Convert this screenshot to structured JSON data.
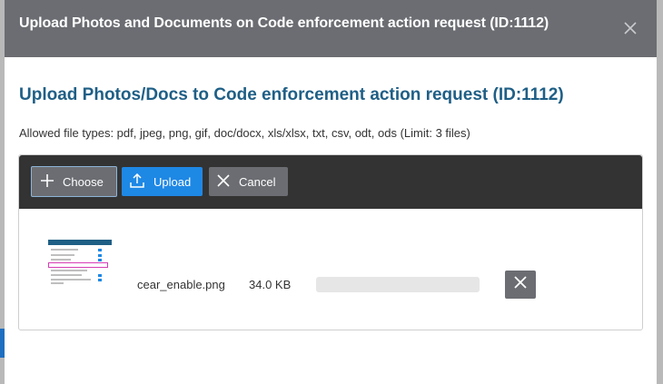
{
  "dialog": {
    "title": "Upload Photos and Documents on Code enforcement action request (ID:1112)",
    "close_icon": "close-icon"
  },
  "content": {
    "title": "Upload Photos/Docs to Code enforcement action request (ID:1112)",
    "allowed_types": "Allowed file types: pdf, jpeg, png, gif, doc/docx, xls/xlsx, txt, csv, odt, ods (Limit: 3 files)"
  },
  "toolbar": {
    "choose_label": "Choose",
    "choose_icon": "plus-icon",
    "upload_label": "Upload",
    "upload_icon": "upload-icon",
    "cancel_label": "Cancel",
    "cancel_icon": "close-icon"
  },
  "files": [
    {
      "name": "cear_enable.png",
      "size": "34.0 KB",
      "progress": 0,
      "thumbnail_icon": "image-thumbnail",
      "remove_icon": "close-icon"
    }
  ],
  "colors": {
    "header_bg": "#6b6d72",
    "title_blue": "#1f5f86",
    "toolbar_bg": "#333333",
    "primary": "#1e88e5",
    "secondary": "#6b6d72"
  }
}
